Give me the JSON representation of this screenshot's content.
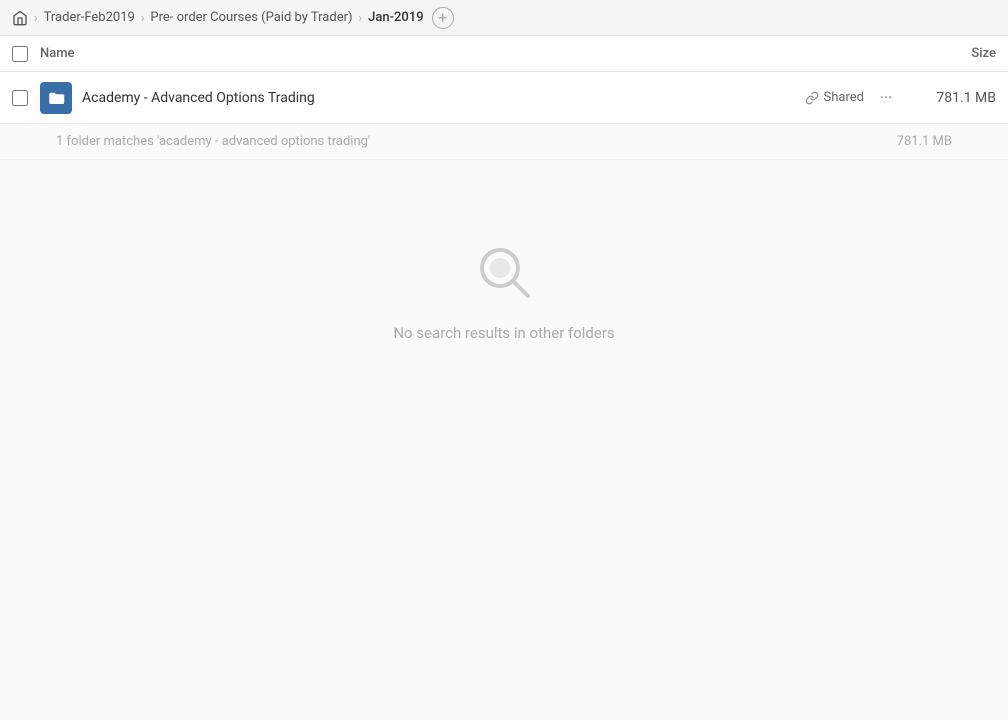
{
  "breadcrumb": {
    "home_icon": "home",
    "items": [
      {
        "label": "Trader-Feb2019",
        "active": false
      },
      {
        "label": "Pre- order Courses (Paid by Trader)",
        "active": false
      },
      {
        "label": "Jan-2019",
        "active": true
      }
    ],
    "add_label": "+"
  },
  "table": {
    "header": {
      "name_label": "Name",
      "size_label": "Size"
    },
    "file": {
      "name": "Academy - Advanced Options Trading",
      "shared_label": "Shared",
      "size": "781.1 MB",
      "more_icon": "···"
    },
    "search_info": {
      "matches_text": "1 folder matches 'academy - advanced options trading'",
      "size": "781.1 MB"
    }
  },
  "empty_state": {
    "text": "No search results in other folders"
  }
}
